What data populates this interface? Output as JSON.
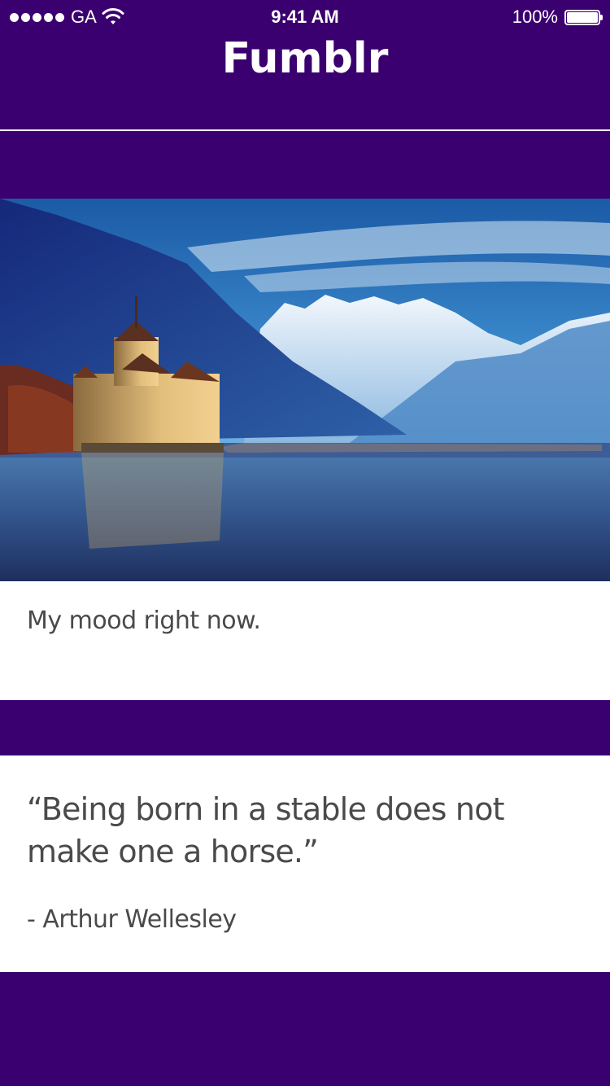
{
  "status_bar": {
    "carrier": "GA",
    "time": "9:41 AM",
    "battery_percent": "100%",
    "battery_level": 1.0,
    "signal_icon": "signal-dots-icon",
    "wifi_icon": "wifi-icon",
    "battery_icon": "battery-icon"
  },
  "nav": {
    "title": "Fumblr"
  },
  "posts": [
    {
      "type": "photo",
      "image_icon": "lakeside-castle-mountains-photo",
      "caption": "My mood right now."
    },
    {
      "type": "quote",
      "quote": "“Being born in a stable does not make one a horse.”",
      "author": "- Arthur Wellesley"
    }
  ],
  "colors": {
    "background": "#3b006f",
    "card": "#ffffff",
    "text": "#4a4a4a"
  }
}
